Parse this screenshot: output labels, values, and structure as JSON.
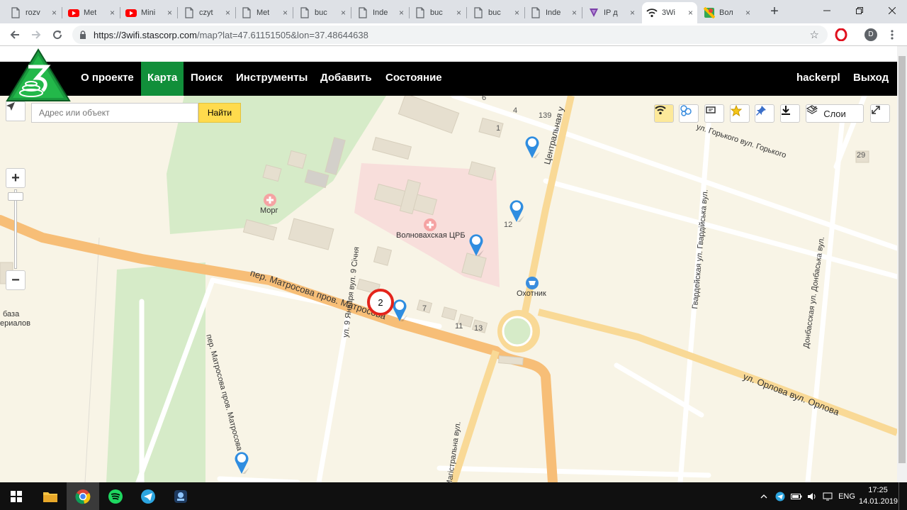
{
  "browser": {
    "tabs": [
      {
        "title": "rozv",
        "icon": "doc-icon"
      },
      {
        "title": "Met",
        "icon": "youtube-icon"
      },
      {
        "title": "Mini",
        "icon": "youtube-icon"
      },
      {
        "title": "czyt",
        "icon": "doc-icon"
      },
      {
        "title": "Met",
        "icon": "doc-icon"
      },
      {
        "title": "buc",
        "icon": "doc-icon"
      },
      {
        "title": "Inde",
        "icon": "doc-icon"
      },
      {
        "title": "buc",
        "icon": "doc-icon"
      },
      {
        "title": "buc",
        "icon": "doc-icon"
      },
      {
        "title": "Inde",
        "icon": "doc-icon"
      },
      {
        "title": "IP д",
        "icon": "viber-icon"
      },
      {
        "title": "3Wi",
        "icon": "wifi-icon",
        "active": true
      },
      {
        "title": "Вол",
        "icon": "maps-icon"
      }
    ],
    "new_tab": "+",
    "url_host": "https://3wifi.stascorp.com",
    "url_rest": "/map?lat=47.61151505&lon=37.48644638",
    "profile_initial": "D"
  },
  "site": {
    "nav": [
      {
        "label": "О проекте"
      },
      {
        "label": "Карта",
        "active": true
      },
      {
        "label": "Поиск"
      },
      {
        "label": "Инструменты"
      },
      {
        "label": "Добавить"
      },
      {
        "label": "Состояние"
      }
    ],
    "user": "hackerpl",
    "logout": "Выход"
  },
  "map": {
    "search_placeholder": "Адрес или объект",
    "search_button": "Найти",
    "layers_label": "Слои",
    "cluster_count": "2",
    "zoom_in": "+",
    "zoom_out": "−",
    "pois": {
      "morg": "Морг",
      "hospital": "Волноваxская ЦРБ",
      "shop": "Охотник",
      "base_line1": "база",
      "base_line2": "ериалов"
    },
    "streets": {
      "matrosova_main": "пер. Матросова  пров. Матросова",
      "matrosova_vert": "пер. Матросова пров. Матросова",
      "yanvarya": "ул. 9 Января вул. 9 Січня",
      "tsentralnaya": "Центральная у",
      "gorkogo": "ул. Горького вул. Горького",
      "gvardeyskaya": "Гвардейская ул. Гвардійська вул.",
      "donbasskaya": "Донбасская ул. Донбаська вул.",
      "orlova": "ул. Орлова вул. Орлова",
      "magistralna": "Магістральна вул."
    },
    "house_numbers": [
      "6",
      "4",
      "139",
      "1",
      "29",
      "12",
      "7",
      "11",
      "13"
    ]
  },
  "taskbar": {
    "lang": "ENG",
    "time": "17:25",
    "date": "14.01.2019"
  }
}
